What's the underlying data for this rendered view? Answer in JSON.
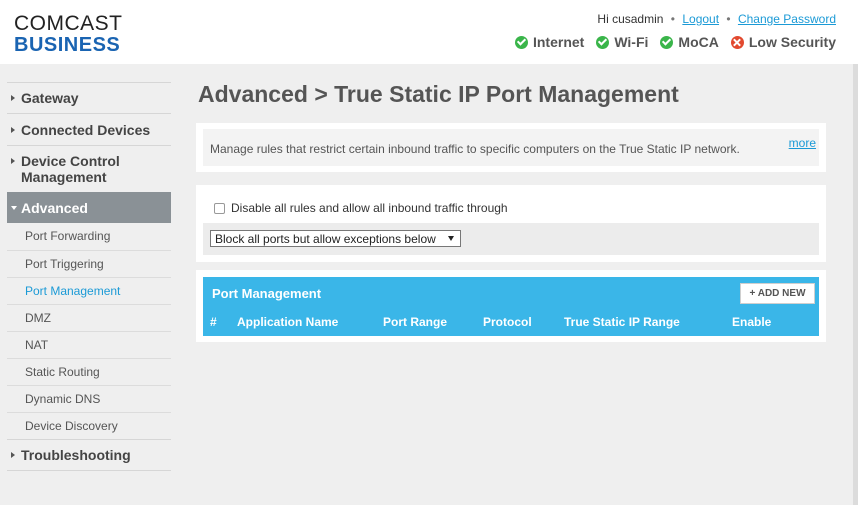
{
  "header": {
    "logo_line1": "COMCAST",
    "logo_line2": "BUSINESS",
    "greeting": "Hi cusadmin",
    "logout": "Logout",
    "change_password": "Change Password",
    "status": [
      {
        "label": "Internet",
        "state": "ok"
      },
      {
        "label": "Wi-Fi",
        "state": "ok"
      },
      {
        "label": "MoCA",
        "state": "ok"
      },
      {
        "label": "Low Security",
        "state": "warning"
      }
    ]
  },
  "sidebar": {
    "gateway": "Gateway",
    "connected_devices": "Connected Devices",
    "device_control_line1": "Device Control",
    "device_control_line2": "Management",
    "advanced": "Advanced",
    "sub_items": [
      "Port Forwarding",
      "Port Triggering",
      "Port Management",
      "DMZ",
      "NAT",
      "Static Routing",
      "Dynamic DNS",
      "Device Discovery"
    ],
    "troubleshooting": "Troubleshooting"
  },
  "main": {
    "title": "Advanced > True Static IP Port Management",
    "info_text": "Manage rules that restrict certain inbound traffic to specific computers on the True Static IP network.",
    "more_link": "more",
    "disable_rules_label": "Disable all rules and allow all inbound traffic through",
    "rule_select_value": "Block all ports but allow exceptions below",
    "port_management": {
      "title": "Port Management",
      "add_button": "+ ADD NEW",
      "columns": [
        "#",
        "Application Name",
        "Port Range",
        "Protocol",
        "True Static IP Range",
        "Enable"
      ]
    }
  },
  "colors": {
    "accent": "#3ab6e8",
    "brand_blue": "#1a64b2",
    "link": "#1b9ad6",
    "nav_active": "#8a9196",
    "ok": "#3ab54a",
    "warning": "#e2492f"
  }
}
